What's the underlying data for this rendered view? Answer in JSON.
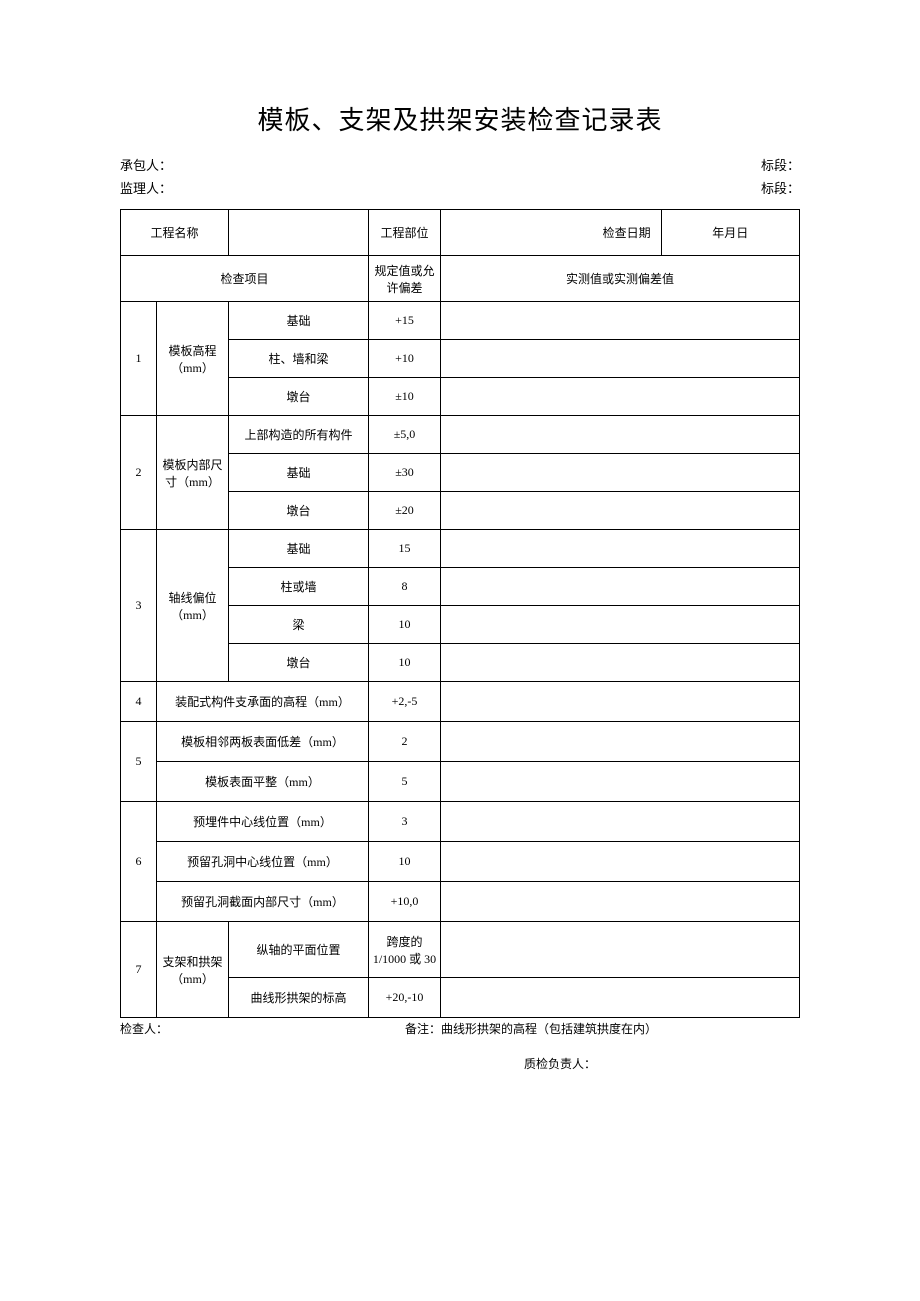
{
  "title": "模板、支架及拱架安装检查记录表",
  "info": {
    "contractor_label_colon": "承包人：",
    "supervisor_label_colon": "监理人：",
    "section_label_colon": "标段："
  },
  "header": {
    "project_name_label": "工程名称",
    "project_part_label": "工程部位",
    "check_date_label": "检查日期",
    "date_placeholder": "年月日",
    "check_item_label": "检查项目",
    "spec_label": "规定值或允许偏差",
    "measured_label": "实测值或实测偏差值"
  },
  "rows": [
    {
      "num": "1",
      "category": "模板高程（mm）",
      "items": [
        {
          "name": "基础",
          "spec": "+15"
        },
        {
          "name": "柱、墙和梁",
          "spec": "+10"
        },
        {
          "name": "墩台",
          "spec": "±10"
        }
      ]
    },
    {
      "num": "2",
      "category": "模板内部尺寸（mm）",
      "items": [
        {
          "name": "上部构造的所有构件",
          "spec": "±5,0"
        },
        {
          "name": "基础",
          "spec": "±30"
        },
        {
          "name": "墩台",
          "spec": "±20"
        }
      ]
    },
    {
      "num": "3",
      "category": "轴线偏位（mm）",
      "items": [
        {
          "name": "基础",
          "spec": "15"
        },
        {
          "name": "柱或墙",
          "spec": "8"
        },
        {
          "name": "梁",
          "spec": "10"
        },
        {
          "name": "墩台",
          "spec": "10"
        }
      ]
    },
    {
      "num": "4",
      "merged_item": "装配式构件支承面的高程（mm）",
      "spec": "+2,-5"
    },
    {
      "num": "5",
      "lines": [
        {
          "merged_item": "模板相邻两板表面低差（mm）",
          "spec": "2"
        },
        {
          "merged_item": "模板表面平整（mm）",
          "spec": "5"
        }
      ]
    },
    {
      "num": "6",
      "lines": [
        {
          "merged_item": "预埋件中心线位置（mm）",
          "spec": "3"
        },
        {
          "merged_item": "预留孔洞中心线位置（mm）",
          "spec": "10"
        },
        {
          "merged_item": "预留孔洞截面内部尺寸（mm）",
          "spec": "+10,0"
        }
      ]
    },
    {
      "num": "7",
      "category": "支架和拱架（mm）",
      "items": [
        {
          "name": "纵轴的平面位置",
          "spec": "跨度的 1/1000 或 30"
        },
        {
          "name": "曲线形拱架的标高",
          "spec": "+20,-10"
        }
      ]
    }
  ],
  "footer": {
    "inspector_label_colon": "检查人：",
    "remark": "备注：曲线形拱架的高程（包括建筑拱度在内）",
    "qc_label_colon": "质检负责人："
  }
}
